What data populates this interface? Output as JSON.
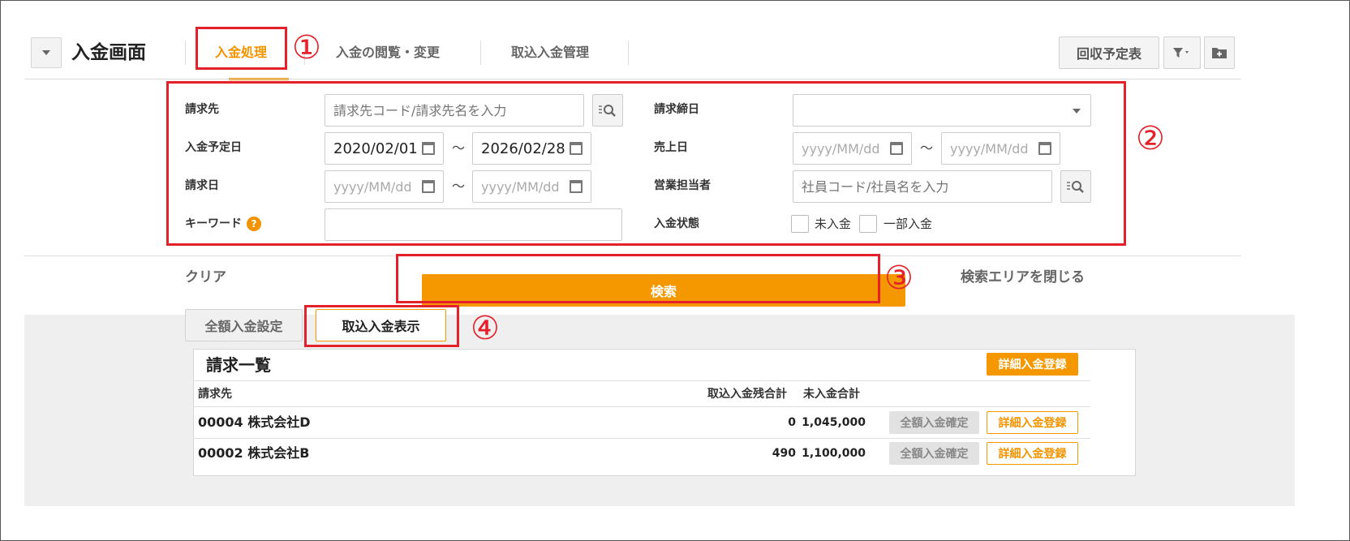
{
  "header": {
    "title": "入金画面",
    "tabs": [
      {
        "label": "入金処理",
        "active": true
      },
      {
        "label": "入金の閲覧・変更",
        "active": false
      },
      {
        "label": "取込入金管理",
        "active": false
      }
    ],
    "schedule_button": "回収予定表"
  },
  "search": {
    "customer": {
      "label": "請求先",
      "placeholder": "請求先コード/請求先名を入力"
    },
    "closing_date": {
      "label": "請求締日",
      "value": ""
    },
    "planned_date": {
      "label": "入金予定日",
      "from": "2020/02/01",
      "to": "2026/02/28"
    },
    "sales_date": {
      "label": "売上日",
      "from_placeholder": "yyyy/MM/dd",
      "to_placeholder": "yyyy/MM/dd"
    },
    "invoice_date": {
      "label": "請求日",
      "from_placeholder": "yyyy/MM/dd",
      "to_placeholder": "yyyy/MM/dd"
    },
    "sales_rep": {
      "label": "営業担当者",
      "placeholder": "社員コード/社員名を入力"
    },
    "keyword": {
      "label": "キーワード",
      "help": "?",
      "value": ""
    },
    "status": {
      "label": "入金状態",
      "options": [
        {
          "label": "未入金"
        },
        {
          "label": "一部入金"
        }
      ]
    },
    "tilde": "～"
  },
  "actions": {
    "clear": "クリア",
    "search": "検索",
    "close_area": "検索エリアを閉じる"
  },
  "subtabs": [
    {
      "label": "全額入金設定",
      "active": false
    },
    {
      "label": "取込入金表示",
      "active": true
    }
  ],
  "invoice_list": {
    "title": "請求一覧",
    "detail_button": "詳細入金登録",
    "columns": {
      "customer": "請求先",
      "imported_remaining": "取込入金残合計",
      "unpaid_total": "未入金合計"
    },
    "rows": [
      {
        "customer": "00004 株式会社D",
        "imported_remaining": "0",
        "unpaid_total": "1,045,000",
        "confirm_label": "全額入金確定",
        "detail_label": "詳細入金登録"
      },
      {
        "customer": "00002 株式会社B",
        "imported_remaining": "490",
        "unpaid_total": "1,100,000",
        "confirm_label": "全額入金確定",
        "detail_label": "詳細入金登録"
      }
    ]
  },
  "annotations": [
    "①",
    "②",
    "③",
    "④"
  ],
  "colors": {
    "accent": "#f29400",
    "annotation_red": "#e4212a"
  },
  "icons": [
    "chevron-down-icon",
    "filter-icon",
    "folder-add-icon",
    "calendar-icon",
    "list-search-icon",
    "help-icon"
  ]
}
